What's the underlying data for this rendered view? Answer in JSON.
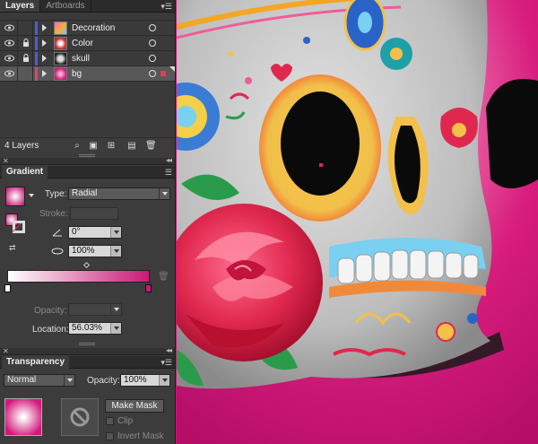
{
  "layers_panel": {
    "tabs": [
      "Layers",
      "Artboards"
    ],
    "active_tab": "Layers",
    "layers": [
      {
        "name": "Decoration",
        "color": "#4a5bdc",
        "locked": false,
        "selected": false
      },
      {
        "name": "Color",
        "color": "#4a5bdc",
        "locked": true,
        "selected": false
      },
      {
        "name": "skull",
        "color": "#4a5bdc",
        "locked": true,
        "selected": false
      },
      {
        "name": "bg",
        "color": "#e0446a",
        "locked": false,
        "selected": true
      }
    ],
    "count_label": "4 Layers"
  },
  "gradient_panel": {
    "title": "Gradient",
    "type_label": "Type:",
    "type_value": "Radial",
    "stroke_label": "Stroke:",
    "angle_value": "0°",
    "aspect_value": "100%",
    "opacity_label": "Opacity:",
    "opacity_value": "",
    "location_label": "Location:",
    "location_value": "56.03%",
    "colors": {
      "start": "#ffffff",
      "end": "#c81a76"
    }
  },
  "transparency_panel": {
    "title": "Transparency",
    "blend_mode": "Normal",
    "opacity_label": "Opacity:",
    "opacity_value": "100%",
    "make_mask_label": "Make Mask",
    "clip_label": "Clip",
    "invert_mask_label": "Invert Mask"
  },
  "icons": {
    "eye": "eye-icon",
    "lock": "lock-icon",
    "search": "locate-object-icon",
    "new_layer": "new-layer-icon",
    "delete": "trash-icon"
  }
}
